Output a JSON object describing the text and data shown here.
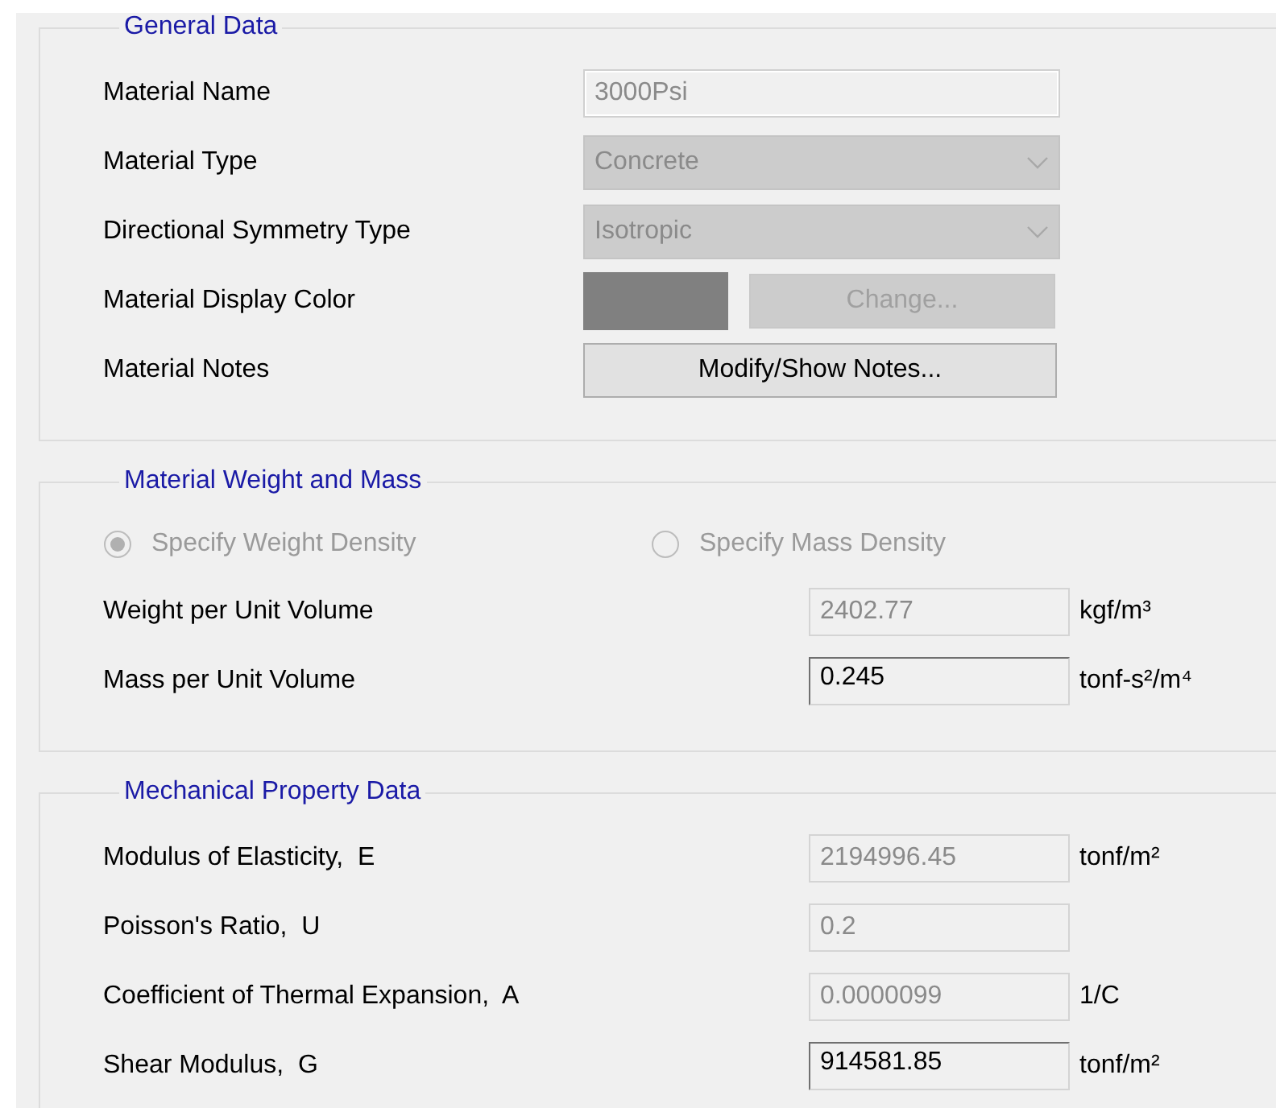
{
  "groups": [
    {
      "title": "General Data",
      "kind": "general",
      "rows": [
        {
          "label": "Material Name",
          "kind": "text",
          "value": "3000Psi",
          "disabled": true
        },
        {
          "label": "Material Type",
          "kind": "dropdown",
          "value": "Concrete",
          "disabled": true
        },
        {
          "label": "Directional Symmetry Type",
          "kind": "dropdown",
          "value": "Isotropic",
          "disabled": true
        },
        {
          "label": "Material Display Color",
          "kind": "color",
          "color": "#808080",
          "button": "Change...",
          "disabled": true
        },
        {
          "label": "Material Notes",
          "kind": "button",
          "button": "Modify/Show Notes...",
          "disabled": false
        }
      ]
    },
    {
      "title": "Material Weight and Mass",
      "kind": "values",
      "options": [
        {
          "label": "Specify Weight Density",
          "selected": true,
          "disabled": true
        },
        {
          "label": "Specify Mass Density",
          "selected": false,
          "disabled": true
        }
      ],
      "rows": [
        {
          "label": "Weight per Unit Volume",
          "kind": "number",
          "value": "2402.77",
          "unit": "kgf/m³",
          "disabled": true
        },
        {
          "label": "Mass per Unit Volume",
          "kind": "number",
          "value": "0.245",
          "unit": "tonf-s²/m⁴",
          "disabled": false
        }
      ]
    },
    {
      "title": "Mechanical Property Data",
      "kind": "values",
      "rows": [
        {
          "label": "Modulus of Elasticity,  E",
          "kind": "number",
          "value": "2194996.45",
          "unit": "tonf/m²",
          "disabled": true
        },
        {
          "label": "Poisson's Ratio,  U",
          "kind": "number",
          "value": "0.2",
          "disabled": true
        },
        {
          "label": "Coefficient of Thermal Expansion,  A",
          "kind": "number",
          "value": "0.0000099",
          "unit": "1/C",
          "disabled": true
        },
        {
          "label": "Shear Modulus,  G",
          "kind": "number",
          "value": "914581.85",
          "unit": "tonf/m²",
          "disabled": false
        }
      ]
    }
  ]
}
